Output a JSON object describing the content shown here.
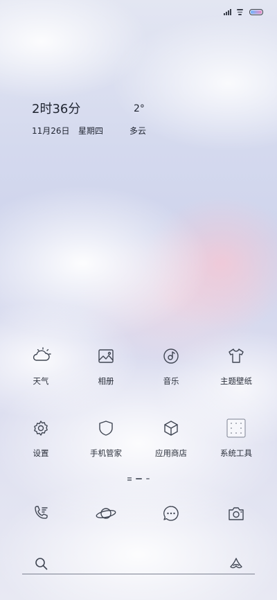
{
  "status_bar": {
    "signal_icon": "signal-icon",
    "wifi_icon": "wifi-icon",
    "battery_icon": "battery-icon",
    "battery_accent": [
      "#6fb6ff",
      "#e98fc6"
    ]
  },
  "widget": {
    "time": "2时36分",
    "temperature": "2°",
    "date": "11月26日",
    "weekday": "星期四",
    "condition": "多云"
  },
  "apps": [
    {
      "label": "天气",
      "icon": "weather-icon"
    },
    {
      "label": "相册",
      "icon": "gallery-icon"
    },
    {
      "label": "音乐",
      "icon": "music-icon"
    },
    {
      "label": "主题壁纸",
      "icon": "theme-icon"
    },
    {
      "label": "设置",
      "icon": "settings-icon"
    },
    {
      "label": "手机管家",
      "icon": "security-icon"
    },
    {
      "label": "应用商店",
      "icon": "app-store-icon"
    },
    {
      "label": "系统工具",
      "icon": "tools-folder-icon"
    }
  ],
  "dock": [
    {
      "icon": "phone-icon"
    },
    {
      "icon": "browser-icon"
    },
    {
      "icon": "messages-icon"
    },
    {
      "icon": "camera-icon"
    }
  ],
  "search": {
    "search_icon": "search-icon",
    "assistant_icon": "assistant-icon"
  }
}
